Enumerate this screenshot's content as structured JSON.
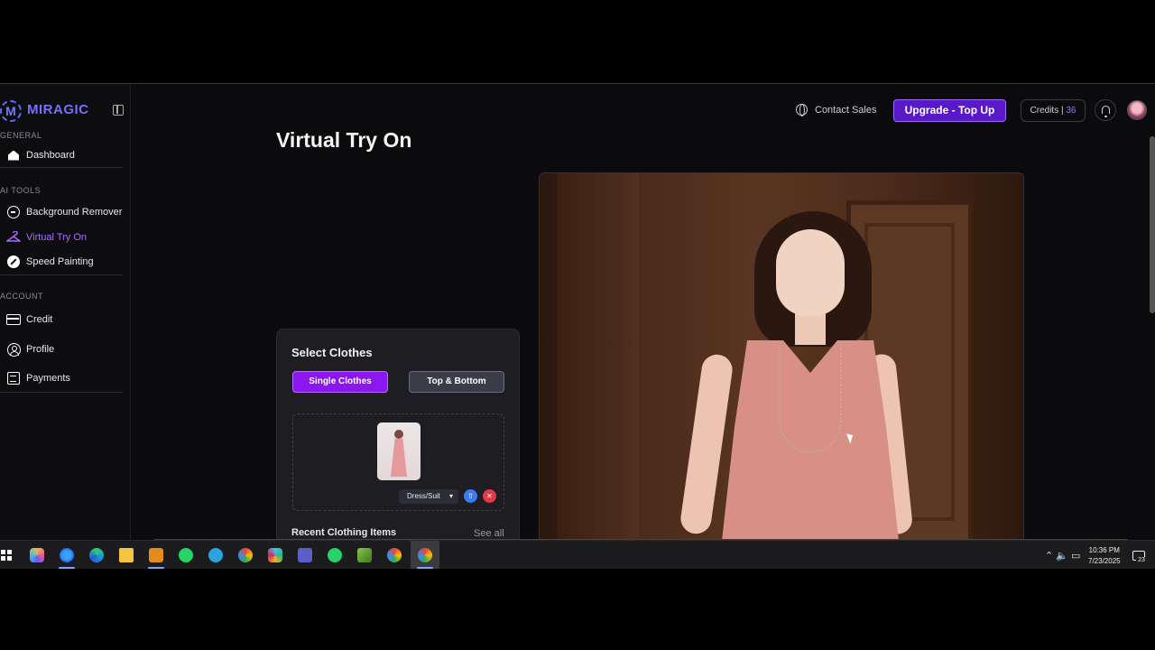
{
  "sidebar": {
    "brand_mark": "M",
    "brand_name": "MIRAGIC",
    "sections": {
      "general": "GENERAL",
      "ai_tools": "AI TOOLS",
      "account": "ACCOUNT"
    },
    "items": [
      {
        "label": "Dashboard",
        "icon": "home-icon"
      },
      {
        "label": "Background Remover",
        "icon": "circle-minus-icon"
      },
      {
        "label": "Virtual Try On",
        "icon": "hanger-icon",
        "active": true
      },
      {
        "label": "Speed Painting",
        "icon": "brush-icon"
      },
      {
        "label": "Credit",
        "icon": "card-icon"
      },
      {
        "label": "Profile",
        "icon": "user-icon"
      },
      {
        "label": "Payments",
        "icon": "wallet-icon"
      }
    ]
  },
  "header": {
    "contact_sales": "Contact Sales",
    "upgrade": "Upgrade - Top Up",
    "credits_label": "Credits |",
    "credits_value": "36"
  },
  "page": {
    "title": "Virtual Try On"
  },
  "select_clothes": {
    "title": "Select Clothes",
    "mode_single": "Single Clothes",
    "mode_top_bottom": "Top & Bottom",
    "clothing_type": "Dress/Suit",
    "recent_title": "Recent Clothing Items",
    "see_all": "See all"
  },
  "taskbar": {
    "time": "10:36 PM",
    "date": "7/23/2025",
    "notification_count": "23"
  },
  "colors": {
    "accent": "#8a16f0",
    "upgrade_bg": "#5a18c8",
    "delete": "#e23a4a",
    "upload": "#3d7cf0"
  }
}
